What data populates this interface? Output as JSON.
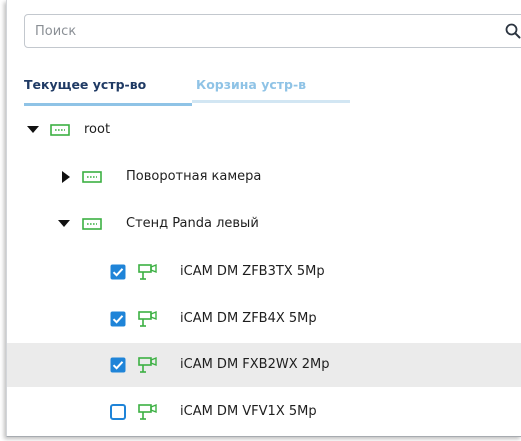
{
  "search": {
    "placeholder": "Поиск"
  },
  "tabs": [
    {
      "label": "Текущее устр-во",
      "active": true
    },
    {
      "label": "Корзина устр-в",
      "active": false
    }
  ],
  "tree": {
    "root": {
      "label": "root",
      "expanded": true
    },
    "nodes": [
      {
        "label": "Поворотная камера",
        "expanded": false
      },
      {
        "label": "Стенд Panda левый",
        "expanded": true
      }
    ],
    "cameras": [
      {
        "label": "iCAM DM ZFB3TX 5Mp",
        "checked": true
      },
      {
        "label": "iCAM DM ZFB4X 5Mp",
        "checked": true
      },
      {
        "label": "iCAM DM FXB2WX 2Mp",
        "checked": true
      },
      {
        "label": "iCAM DM VFV1X 5Mp",
        "checked": false
      }
    ]
  },
  "colors": {
    "accent": "#1f84d8",
    "device_icon": "#3cb043",
    "tab_active_text": "#1f3a64",
    "tab_inactive_text": "#8fc3e6"
  }
}
